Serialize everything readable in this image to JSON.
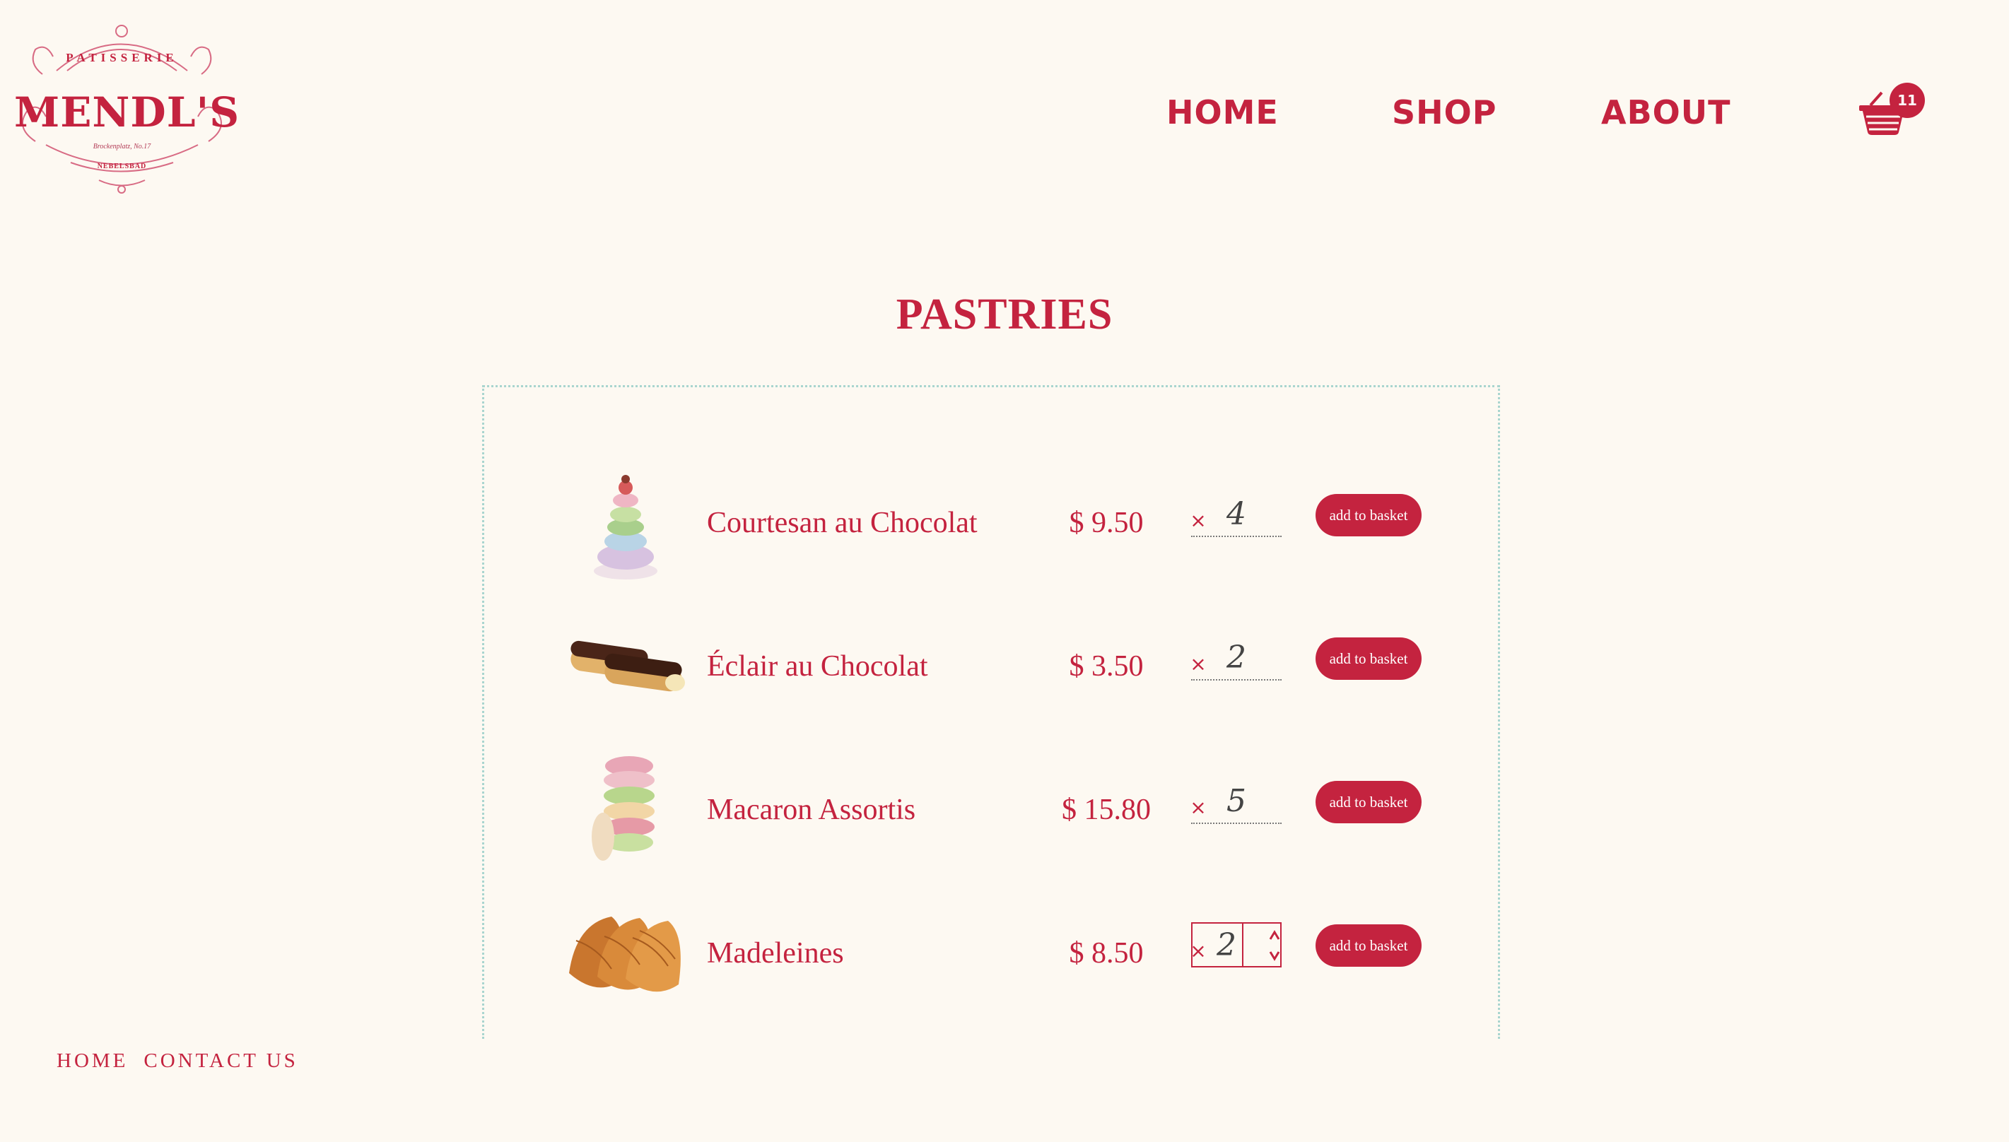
{
  "brand": {
    "name": "MENDL'S",
    "top_text": "PATISSERIE",
    "middle_text": "Brockenplatz, No.17",
    "bottom_text": "NEBELSBAD"
  },
  "nav": {
    "home": "HOME",
    "shop": "SHOP",
    "about": "ABOUT"
  },
  "cart": {
    "icon": "basket-icon",
    "count": "11"
  },
  "page_title": "PASTRIES",
  "products": [
    {
      "name": "Courtesan au Chocolat",
      "price": "$ 9.50",
      "times": "×",
      "quantity": "4",
      "button": "add to basket",
      "icon": "courtesan-image"
    },
    {
      "name": "Éclair au Chocolat",
      "price": "$ 3.50",
      "times": "×",
      "quantity": "2",
      "button": "add to basket",
      "icon": "eclair-image"
    },
    {
      "name": "Macaron Assortis",
      "price": "$ 15.80",
      "times": "×",
      "quantity": "5",
      "button": "add to basket",
      "icon": "macaron-image"
    },
    {
      "name": "Madeleines",
      "price": "$ 8.50",
      "times": "×",
      "quantity": "2",
      "button": "add to basket",
      "icon": "madeleine-image"
    }
  ],
  "footer": {
    "home": "HOME",
    "contact": "CONTACT US"
  },
  "colors": {
    "accent": "#c4233f",
    "background": "#fdf9f2",
    "panel_border": "#a9d5cf"
  }
}
